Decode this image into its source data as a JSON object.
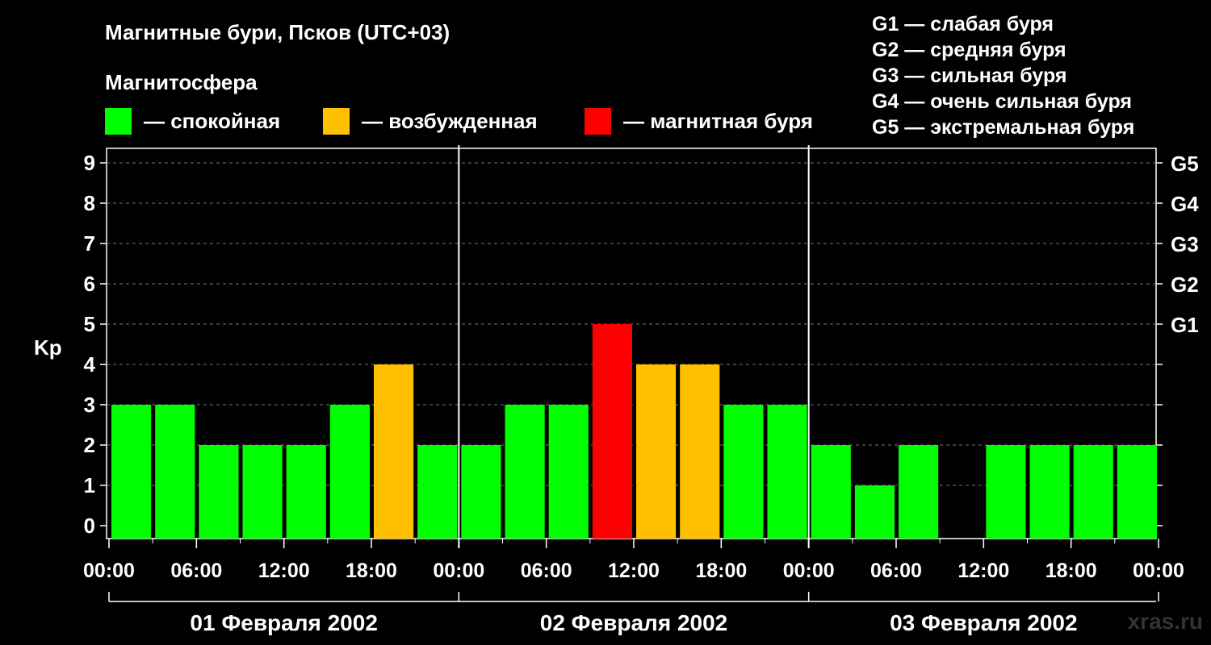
{
  "title": "Магнитные бури, Псков (UTC+03)",
  "subtitle": "Магнитосфера",
  "legend": [
    {
      "label": "— спокойная",
      "color": "#00ff00"
    },
    {
      "label": "— возбужденная",
      "color": "#ffc000"
    },
    {
      "label": "— магнитная буря",
      "color": "#ff0000"
    }
  ],
  "storm_scale": [
    "G1 — слабая буря",
    "G2 — средняя буря",
    "G3 — сильная буря",
    "G4 — очень сильная буря",
    "G5 — экстремальная буря"
  ],
  "watermark": "xras.ru",
  "chart_data": {
    "type": "bar",
    "ylabel": "Kp",
    "ylim": [
      0,
      9
    ],
    "yticks": [
      0,
      1,
      2,
      3,
      4,
      5,
      6,
      7,
      8,
      9
    ],
    "right_ticks": [
      {
        "value": 5,
        "label": "G1"
      },
      {
        "value": 6,
        "label": "G2"
      },
      {
        "value": 7,
        "label": "G3"
      },
      {
        "value": 8,
        "label": "G4"
      },
      {
        "value": 9,
        "label": "G5"
      }
    ],
    "grid": true,
    "xtick_labels": [
      "00:00",
      "06:00",
      "12:00",
      "18:00",
      "00:00",
      "06:00",
      "12:00",
      "18:00",
      "00:00",
      "06:00",
      "12:00",
      "18:00",
      "00:00"
    ],
    "days": [
      "01 Февраля 2002",
      "02 Февраля 2002",
      "03 Февраля 2002"
    ],
    "interval_hours": 3,
    "values": [
      3,
      3,
      2,
      2,
      2,
      3,
      4,
      2,
      2,
      3,
      3,
      5,
      4,
      4,
      3,
      3,
      2,
      1,
      2,
      0,
      2,
      2,
      2,
      2
    ],
    "colors": {
      "quiet": "#00ff00",
      "active": "#ffc000",
      "storm": "#ff0000"
    }
  }
}
